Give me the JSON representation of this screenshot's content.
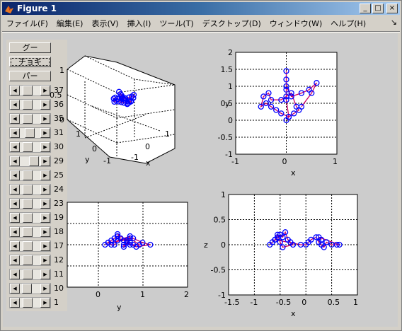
{
  "window": {
    "title": "Figure 1",
    "minimize": "_",
    "maximize": "□",
    "close": "×"
  },
  "menu": [
    "ファイル(F)",
    "編集(E)",
    "表示(V)",
    "挿入(I)",
    "ツール(T)",
    "デスクトップ(D)",
    "ウィンドウ(W)",
    "ヘルプ(H)"
  ],
  "dock_icon": "↘",
  "panel": {
    "buttons": [
      "グー",
      "チョキ",
      "パー"
    ],
    "sliders": [
      {
        "value": "37",
        "level": 0.25
      },
      {
        "value": "36",
        "level": 0.25
      },
      {
        "value": "35",
        "level": 0.25
      },
      {
        "value": "31",
        "level": 0.4
      },
      {
        "value": "30",
        "level": 0.25
      },
      {
        "value": "29",
        "level": 0.75
      },
      {
        "value": "25",
        "level": 0.25
      },
      {
        "value": "24",
        "level": 0.25
      },
      {
        "value": "23",
        "level": 0.25
      },
      {
        "value": "19",
        "level": 0.25
      },
      {
        "value": "18",
        "level": 0.25
      },
      {
        "value": "17",
        "level": 0.25
      },
      {
        "value": "12",
        "level": 0.25
      },
      {
        "value": "11",
        "level": 0.25
      },
      {
        "value": "10",
        "level": 0.2
      },
      {
        "value": "1",
        "level": 0.25
      }
    ]
  },
  "plots": {
    "p3d": {
      "zticks": [
        "1",
        "0.5",
        "0"
      ],
      "yticks": [
        "1",
        "0",
        "-1"
      ],
      "xticks": [
        "-1",
        "0",
        "1"
      ],
      "ylabel": "y",
      "xlabel": "x"
    },
    "xy": {
      "xticks": [
        "-1",
        "0",
        "1"
      ],
      "yticks": [
        "2",
        "1.5",
        "1",
        "0.5",
        "0",
        "-0.5",
        "-1"
      ],
      "xlabel": "x",
      "ylabel": "y"
    },
    "yz": {
      "xticks": [
        "0",
        "1",
        "2"
      ],
      "xlabel": "y"
    },
    "xz": {
      "xticks": [
        "-1.5",
        "-1",
        "-0.5",
        "0",
        "0.5",
        "1"
      ],
      "yticks": [
        "1",
        "0.5",
        "0",
        "-0.5",
        "-1"
      ],
      "xlabel": "x",
      "ylabel": "z"
    }
  },
  "colors": {
    "marker": "#0000ff",
    "line": "#cc0066"
  },
  "chart_data": [
    {
      "type": "scatter",
      "title": "",
      "xlabel": "x",
      "ylabel": "y",
      "xlim": [
        -1,
        1
      ],
      "ylim": [
        -1,
        2
      ],
      "x": [
        0,
        0.05,
        -0.1,
        -0.2,
        -0.3,
        -0.4,
        -0.5,
        -0.45,
        -0.35,
        -0.3,
        -0.1,
        0,
        0.1,
        0.2,
        0.25,
        0.15,
        0.05,
        0,
        0,
        0,
        0,
        0,
        0.1,
        0.3,
        0.45,
        0.6,
        0.5,
        0.3
      ],
      "y": [
        0,
        0.1,
        0.2,
        0.3,
        0.4,
        0.5,
        0.4,
        0.7,
        0.8,
        0.6,
        0.6,
        0.7,
        0.8,
        0.4,
        0.3,
        0.2,
        0.1,
        0.6,
        0.9,
        1.2,
        1.45,
        1.0,
        0.7,
        0.8,
        0.9,
        1.1,
        0.8,
        0.4
      ]
    },
    {
      "type": "scatter",
      "title": "",
      "xlabel": "x",
      "ylabel": "z",
      "xlim": [
        -1.5,
        1
      ],
      "ylim": [
        -1,
        1
      ],
      "x": [
        -0.7,
        -0.65,
        -0.6,
        -0.55,
        -0.5,
        -0.45,
        -0.4,
        -0.35,
        -0.3,
        -0.25,
        -0.45,
        -0.5,
        -0.55,
        -0.6,
        -0.1,
        0,
        0.05,
        0.1,
        0.2,
        0.25,
        0.3,
        0.35,
        0.4,
        0.5,
        0.6,
        0.65,
        0.25,
        0.3
      ],
      "y": [
        0,
        0.05,
        0.1,
        0.15,
        0.2,
        0.15,
        0.25,
        0.1,
        0.05,
        0,
        -0.05,
        0.05,
        0.2,
        0.1,
        0,
        0,
        0.05,
        0.1,
        0.15,
        0.05,
        0,
        -0.05,
        0.05,
        0,
        0,
        0,
        0.15,
        0.1
      ]
    }
  ]
}
